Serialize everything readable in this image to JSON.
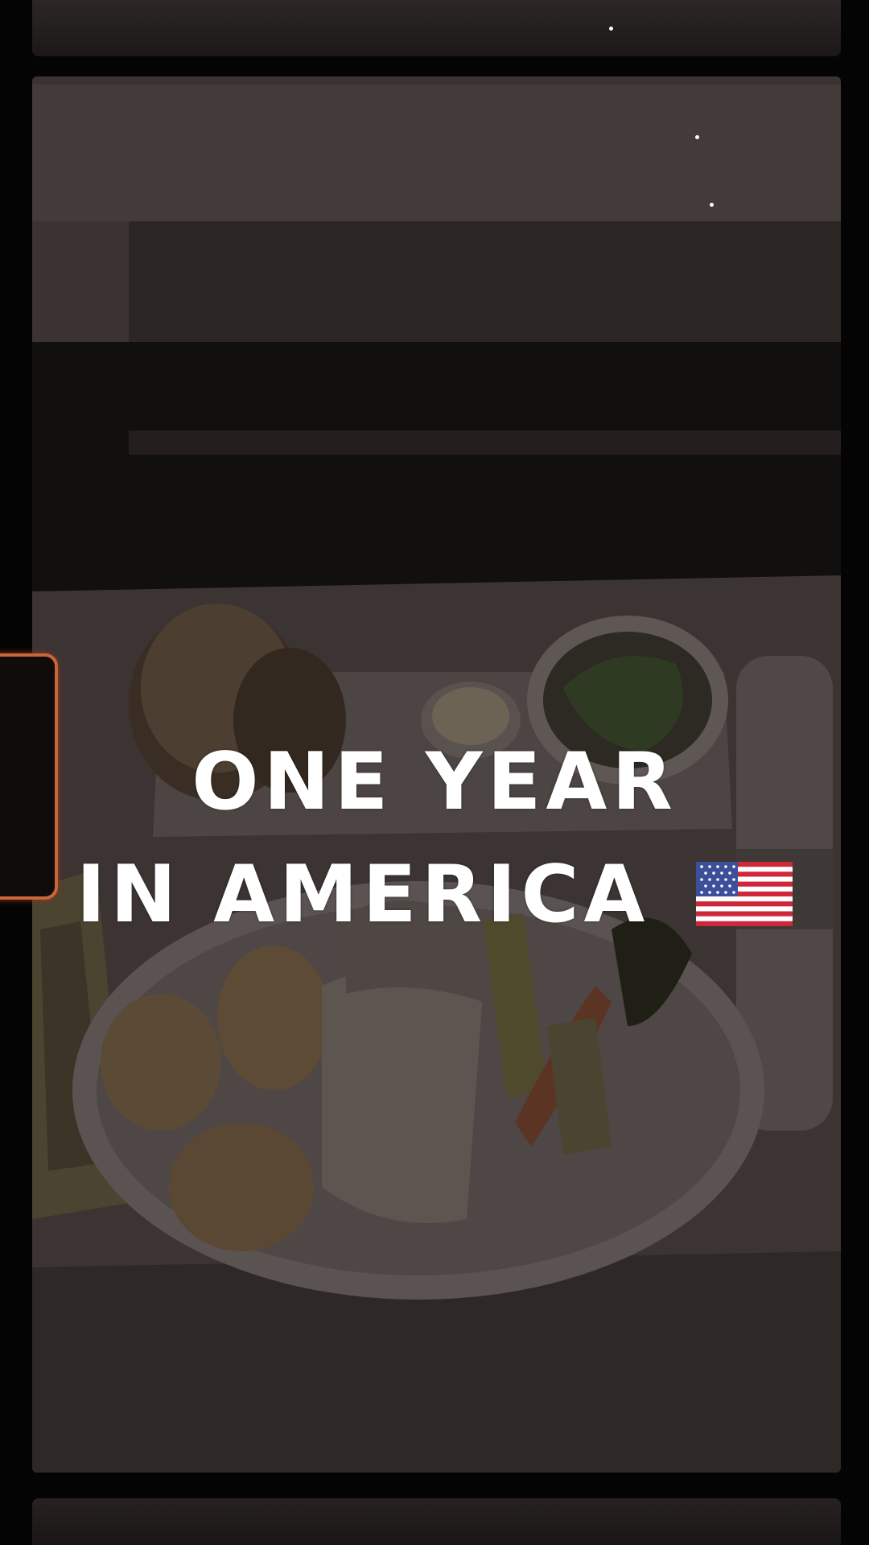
{
  "overlay": {
    "line1": "ONE YEAR",
    "line2": "IN AMERICA",
    "flag_icon": "us-flag-icon"
  },
  "colors": {
    "text": "#ffffff",
    "frame": "#050404",
    "accent_card": "#c9653a"
  }
}
